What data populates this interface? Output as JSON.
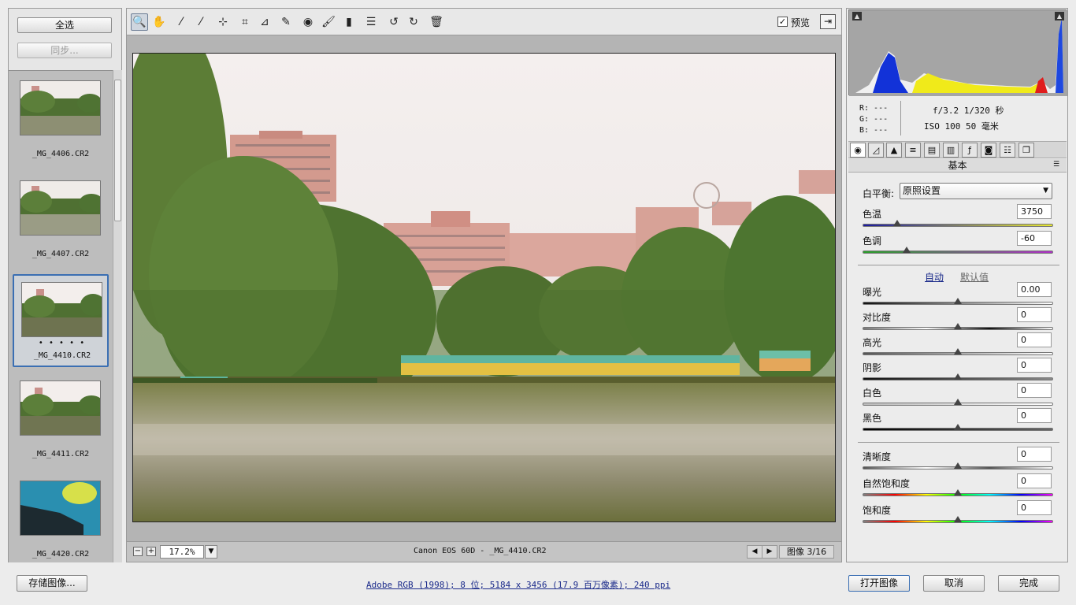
{
  "filmstrip": {
    "select_all_label": "全选",
    "sync_label": "同步...",
    "items": [
      {
        "name": "_MG_4406.CR2",
        "selected": false,
        "rating": ""
      },
      {
        "name": "_MG_4407.CR2",
        "selected": false,
        "rating": ""
      },
      {
        "name": "_MG_4410.CR2",
        "selected": true,
        "rating": "• • • • •"
      },
      {
        "name": "_MG_4411.CR2",
        "selected": false,
        "rating": ""
      },
      {
        "name": "_MG_4420.CR2",
        "selected": false,
        "rating": ""
      }
    ]
  },
  "toolbar": {
    "tools": [
      {
        "name": "zoom-tool",
        "glyph": "🔍"
      },
      {
        "name": "hand-tool",
        "glyph": "✋"
      },
      {
        "name": "white-balance-tool",
        "glyph": "⁄"
      },
      {
        "name": "color-sampler-tool",
        "glyph": "⁄"
      },
      {
        "name": "targeted-adjustment-tool",
        "glyph": "⊹"
      },
      {
        "name": "crop-tool",
        "glyph": "⌗"
      },
      {
        "name": "straighten-tool",
        "glyph": "⊿"
      },
      {
        "name": "spot-removal-tool",
        "glyph": "✎"
      },
      {
        "name": "red-eye-tool",
        "glyph": "◉"
      },
      {
        "name": "adjustment-brush-tool",
        "glyph": "🖌"
      },
      {
        "name": "graduated-filter-tool",
        "glyph": "▮"
      },
      {
        "name": "preferences-tool",
        "glyph": "☰"
      },
      {
        "name": "rotate-left-tool",
        "glyph": "↺"
      },
      {
        "name": "rotate-right-tool",
        "glyph": "↻"
      },
      {
        "name": "trash-tool",
        "glyph": "🗑"
      }
    ],
    "preview_label": "预览",
    "preview_checked": "✓",
    "fullscreen_glyph": "⇥"
  },
  "status": {
    "zoom_out": "−",
    "zoom_in": "+",
    "zoom_value": "17.2%",
    "zoom_dropdown": "▼",
    "camera_info": "Canon EOS 60D -  _MG_4410.CR2",
    "prev": "◀",
    "next": "▶",
    "image_counter": "图像 3/16"
  },
  "info": {
    "r": "R:  ---",
    "g": "G:  ---",
    "b": "B:  ---",
    "exposure": "f/3.2  1/320 秒",
    "iso": "ISO 100  50 毫米"
  },
  "panel": {
    "section_title": "基本",
    "white_balance_label": "白平衡:",
    "white_balance_value": "原照设置",
    "auto_label": "自动",
    "default_label": "默认值",
    "sliders": [
      {
        "label": "色温",
        "value": "3750",
        "pos": 0.18
      },
      {
        "label": "色调",
        "value": "-60",
        "pos": 0.23
      },
      {
        "label": "曝光",
        "value": "0.00",
        "pos": 0.5
      },
      {
        "label": "对比度",
        "value": "0",
        "pos": 0.5
      },
      {
        "label": "高光",
        "value": "0",
        "pos": 0.5
      },
      {
        "label": "阴影",
        "value": "0",
        "pos": 0.5
      },
      {
        "label": "白色",
        "value": "0",
        "pos": 0.5
      },
      {
        "label": "黑色",
        "value": "0",
        "pos": 0.5
      },
      {
        "label": "清晰度",
        "value": "0",
        "pos": 0.5
      },
      {
        "label": "自然饱和度",
        "value": "0",
        "pos": 0.5
      },
      {
        "label": "饱和度",
        "value": "0",
        "pos": 0.5
      }
    ]
  },
  "footer": {
    "save_label": "存储图像...",
    "workflow": "Adobe RGB (1998); 8 位; 5184 x 3456 (17.9 百万像素); 240 ppi",
    "open_label": "打开图像",
    "cancel_label": "取消",
    "done_label": "完成"
  },
  "colors": {
    "accent": "#3b6fb3",
    "link": "#1a2a8a"
  }
}
